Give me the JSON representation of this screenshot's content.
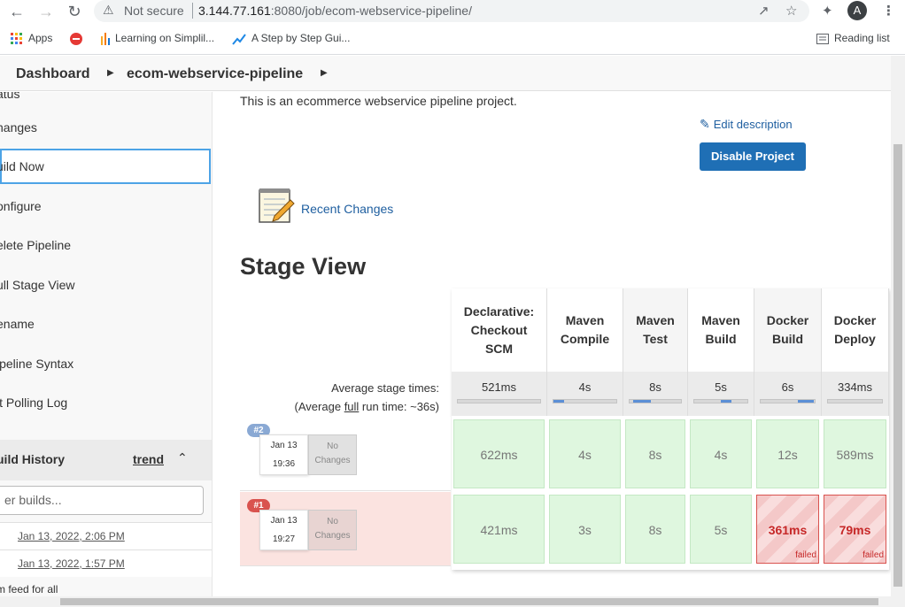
{
  "browser": {
    "not_secure": "Not secure",
    "url_host": "3.144.77.161",
    "url_path": ":8080/job/ecom-webservice-pipeline/",
    "avatar_letter": "A",
    "bookmarks": [
      "Apps",
      "Learning on Simplil...",
      "A Step by Step Gui..."
    ],
    "reading_list": "Reading list"
  },
  "breadcrumb": {
    "dashboard": "Dashboard",
    "job": "ecom-webservice-pipeline"
  },
  "sidebar": {
    "partial_top": "atus",
    "items": [
      {
        "label": "hanges"
      },
      {
        "label": "uild Now"
      },
      {
        "label": "onfigure"
      },
      {
        "label": "elete Pipeline"
      },
      {
        "label": "ull Stage View"
      },
      {
        "label": "ename"
      },
      {
        "label": "ipeline Syntax"
      },
      {
        "label": "it Polling Log"
      }
    ],
    "build_history": {
      "title": "uild History",
      "trend": "trend",
      "filter_placeholder": "er builds...",
      "rows": [
        "Jan 13, 2022, 2:06 PM",
        "Jan 13, 2022, 1:57 PM"
      ],
      "footer": "m feed for all"
    }
  },
  "main": {
    "description": "This is an ecommerce webservice pipeline project.",
    "edit_description": "Edit description",
    "disable_button": "Disable Project",
    "recent_changes": "Recent Changes",
    "stage_view_title": "Stage View",
    "avg_stage_label": "Average stage times:",
    "avg_run_prefix": "(Average ",
    "avg_run_full": "full",
    "avg_run_suffix": " run time: ~36s)",
    "stages": [
      {
        "name": "Declarative: Checkout SCM",
        "avg": "521ms"
      },
      {
        "name": "Maven Compile",
        "avg": "4s"
      },
      {
        "name": "Maven Test",
        "avg": "8s"
      },
      {
        "name": "Maven Build",
        "avg": "5s"
      },
      {
        "name": "Docker Build",
        "avg": "6s"
      },
      {
        "name": "Docker Deploy",
        "avg": "334ms"
      }
    ],
    "builds": [
      {
        "number": "#2",
        "date": "Jan 13",
        "time": "19:36",
        "changes": "No Changes",
        "results": [
          "622ms",
          "4s",
          "8s",
          "4s",
          "12s",
          "589ms"
        ],
        "failed": [
          false,
          false,
          false,
          false,
          false,
          false
        ]
      },
      {
        "number": "#1",
        "date": "Jan 13",
        "time": "19:27",
        "changes": "No Changes",
        "results": [
          "421ms",
          "3s",
          "8s",
          "5s",
          "361ms",
          "79ms"
        ],
        "failed": [
          false,
          false,
          false,
          false,
          true,
          true
        ]
      }
    ],
    "failed_label": "failed"
  },
  "colors": {
    "success_bg": "#dff7df",
    "failed_bg": "#f4c8c8",
    "badge_success": "#8aa9d4",
    "badge_failed": "#d9534f",
    "link": "#1f5fa0",
    "button": "#1f6fb5"
  }
}
